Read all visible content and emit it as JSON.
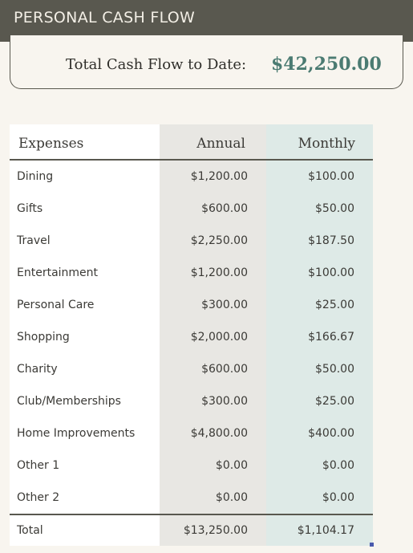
{
  "title": "PERSONAL CASH FLOW",
  "summary": {
    "label": "Total Cash Flow to Date:",
    "value": "$42,250.00"
  },
  "colors": {
    "title_bar": "#59584f",
    "accent_value": "#4b7b72",
    "annual_column": "#e8e7e3",
    "monthly_column": "#deeae7",
    "selection_handle": "#4a5aad"
  },
  "table": {
    "headers": {
      "name": "Expenses",
      "annual": "Annual",
      "monthly": "Monthly"
    },
    "rows": [
      {
        "name": "Dining",
        "annual": "$1,200.00",
        "monthly": "$100.00"
      },
      {
        "name": "Gifts",
        "annual": "$600.00",
        "monthly": "$50.00"
      },
      {
        "name": "Travel",
        "annual": "$2,250.00",
        "monthly": "$187.50"
      },
      {
        "name": "Entertainment",
        "annual": "$1,200.00",
        "monthly": "$100.00"
      },
      {
        "name": "Personal Care",
        "annual": "$300.00",
        "monthly": "$25.00"
      },
      {
        "name": "Shopping",
        "annual": "$2,000.00",
        "monthly": "$166.67"
      },
      {
        "name": "Charity",
        "annual": "$600.00",
        "monthly": "$50.00"
      },
      {
        "name": "Club/Memberships",
        "annual": "$300.00",
        "monthly": "$25.00"
      },
      {
        "name": "Home Improvements",
        "annual": "$4,800.00",
        "monthly": "$400.00"
      },
      {
        "name": "Other 1",
        "annual": "$0.00",
        "monthly": "$0.00"
      },
      {
        "name": "Other 2",
        "annual": "$0.00",
        "monthly": "$0.00"
      }
    ],
    "total": {
      "name": "Total",
      "annual": "$13,250.00",
      "monthly": "$1,104.17"
    }
  }
}
